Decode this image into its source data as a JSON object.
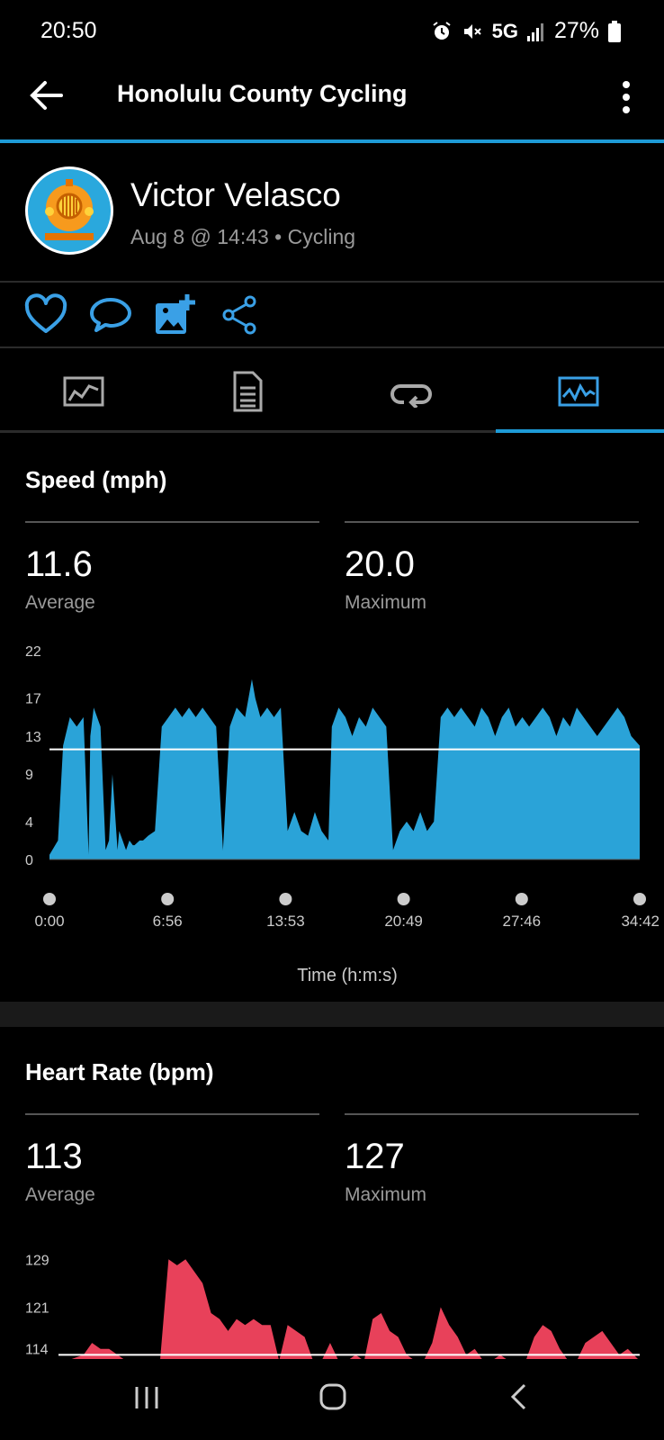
{
  "status_bar": {
    "time": "20:50",
    "network": "5G",
    "battery": "27%",
    "icons": [
      "alarm-icon",
      "mute-icon",
      "signal-icon",
      "battery-icon"
    ]
  },
  "app_bar": {
    "title": "Honolulu County Cycling"
  },
  "activity": {
    "user": "Victor Velasco",
    "meta": "Aug 8 @ 14:43 • Cycling"
  },
  "actions": [
    "like-icon",
    "comment-icon",
    "add-photo-icon",
    "share-icon"
  ],
  "tabs": [
    "map-tab",
    "details-tab",
    "laps-tab",
    "charts-tab"
  ],
  "colors": {
    "accent": "#1e9bd7",
    "speed_fill": "#2aa3d8",
    "hr_fill": "#e8415a"
  },
  "speed": {
    "title": "Speed (mph)",
    "average": "11.6",
    "average_label": "Average",
    "maximum": "20.0",
    "maximum_label": "Maximum",
    "x_axis_title": "Time (h:m:s)"
  },
  "heart_rate": {
    "title": "Heart Rate (bpm)",
    "average": "113",
    "average_label": "Average",
    "maximum": "127",
    "maximum_label": "Maximum"
  },
  "chart_data": [
    {
      "type": "area",
      "title": "Speed (mph)",
      "xlabel": "Time (h:m:s)",
      "ylabel": "",
      "x_ticks": [
        "0:00",
        "6:56",
        "13:53",
        "20:49",
        "27:46",
        "34:42"
      ],
      "y_ticks": [
        "0",
        "4",
        "9",
        "13",
        "17",
        "22"
      ],
      "ylim": [
        0,
        22
      ],
      "x_minutes": [
        0,
        0.5,
        0.8,
        1.2,
        1.6,
        2,
        2.3,
        2.4,
        2.6,
        3,
        3.3,
        3.5,
        3.7,
        4,
        4.1,
        4.3,
        4.5,
        4.7,
        4.9,
        5,
        5.3,
        5.5,
        5.8,
        6.2,
        6.6,
        7,
        7.4,
        7.8,
        8.2,
        8.6,
        9,
        9.4,
        9.8,
        10.2,
        10.6,
        11,
        11.5,
        11.9,
        12.1,
        12.4,
        12.8,
        13.2,
        13.6,
        14,
        14.4,
        14.8,
        15.2,
        15.6,
        16,
        16.4,
        16.6,
        17,
        17.4,
        17.8,
        18.2,
        18.6,
        19,
        19.4,
        19.8,
        20.2,
        20.6,
        21,
        21.4,
        21.8,
        22.2,
        22.6,
        23,
        23.4,
        23.8,
        24.2,
        24.6,
        25,
        25.4,
        25.8,
        26.2,
        26.6,
        27,
        27.4,
        27.8,
        28.2,
        28.6,
        29,
        29.4,
        29.8,
        30.2,
        30.6,
        31,
        31.4,
        31.8,
        32.2,
        32.6,
        33,
        33.4,
        33.8,
        34.2,
        34.7
      ],
      "values": [
        0.5,
        2,
        12,
        15,
        14,
        15,
        0.5,
        13,
        16,
        14,
        1,
        2,
        9,
        1,
        3,
        2,
        1,
        2,
        1.5,
        1.5,
        2,
        2,
        2.5,
        3,
        14,
        15,
        16,
        15,
        16,
        15,
        16,
        15,
        14,
        1,
        14,
        16,
        15,
        19,
        17,
        15,
        16,
        15,
        16,
        3,
        5,
        3,
        2.5,
        5,
        3,
        2,
        14,
        16,
        15,
        13,
        15,
        14,
        16,
        15,
        14,
        1,
        3,
        4,
        3,
        5,
        3,
        4,
        15,
        16,
        15,
        16,
        15,
        14,
        16,
        15,
        13,
        15,
        16,
        14,
        15,
        14,
        15,
        16,
        15,
        13,
        15,
        14,
        16,
        15,
        14,
        13,
        14,
        15,
        16,
        15,
        13,
        12
      ],
      "average": 11.6,
      "grid": false
    },
    {
      "type": "area",
      "title": "Heart Rate (bpm)",
      "xlabel": "",
      "ylabel": "",
      "y_ticks": [
        "114",
        "121",
        "129"
      ],
      "ylim": [
        112,
        131
      ],
      "x_minutes": [
        0,
        1,
        2,
        2.5,
        3,
        3.5,
        4,
        4.5,
        5,
        5.5,
        6,
        6.5,
        7,
        7.5,
        8,
        8.5,
        9,
        9.5,
        10,
        10.5,
        11,
        11.5,
        12,
        12.5,
        13,
        13.5,
        14,
        14.5,
        15,
        15.5,
        16,
        16.5,
        17,
        17.5,
        18,
        18.5,
        19,
        19.5,
        20,
        20.5,
        21,
        21.5,
        22,
        22.5,
        23,
        23.5,
        24,
        24.5,
        25,
        25.5,
        26,
        26.5,
        27,
        27.5,
        28,
        28.5,
        29,
        29.5,
        30,
        30.5,
        31,
        31.5,
        32,
        32.5,
        33,
        33.5,
        34,
        34.7
      ],
      "values": [
        112,
        112,
        113,
        115,
        114,
        114,
        113,
        112,
        112,
        112,
        112,
        112,
        129,
        128,
        129,
        127,
        125,
        120,
        119,
        117,
        119,
        118,
        119,
        118,
        118,
        112,
        118,
        117,
        116,
        112,
        112,
        115,
        112,
        112,
        113,
        112,
        119,
        120,
        117,
        116,
        113,
        112,
        112,
        115,
        121,
        118,
        116,
        113,
        114,
        112,
        112,
        113,
        112,
        112,
        112,
        116,
        118,
        117,
        114,
        112,
        112,
        115,
        116,
        117,
        115,
        113,
        114,
        112
      ],
      "average": 113,
      "grid": false
    }
  ]
}
